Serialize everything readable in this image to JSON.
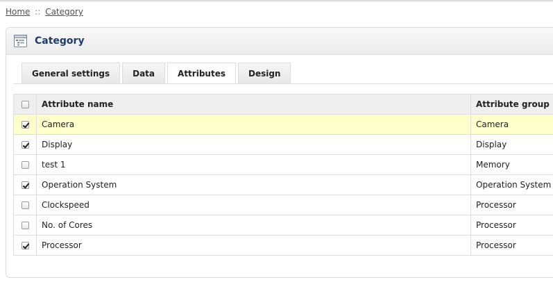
{
  "breadcrumb": {
    "home": "Home",
    "separator": "::",
    "current": "Category"
  },
  "heading": {
    "title": "Category",
    "icon": "category-icon"
  },
  "tabs": [
    {
      "label": "General settings",
      "active": false
    },
    {
      "label": "Data",
      "active": false
    },
    {
      "label": "Attributes",
      "active": true
    },
    {
      "label": "Design",
      "active": false
    }
  ],
  "table": {
    "columns": {
      "name": "Attribute name",
      "group": "Attribute group"
    },
    "header_checked": false,
    "rows": [
      {
        "checked": true,
        "name": "Camera",
        "group": "Camera",
        "highlight": true
      },
      {
        "checked": true,
        "name": "Display",
        "group": "Display",
        "highlight": false
      },
      {
        "checked": false,
        "name": "test 1",
        "group": "Memory",
        "highlight": false
      },
      {
        "checked": true,
        "name": "Operation System",
        "group": "Operation System",
        "highlight": false
      },
      {
        "checked": false,
        "name": "Clockspeed",
        "group": "Processor",
        "highlight": false
      },
      {
        "checked": false,
        "name": "No. of Cores",
        "group": "Processor",
        "highlight": false
      },
      {
        "checked": true,
        "name": "Processor",
        "group": "Processor",
        "highlight": false
      }
    ]
  },
  "colors": {
    "title": "#1e3a6e",
    "highlight_row": "#ffffcb"
  }
}
